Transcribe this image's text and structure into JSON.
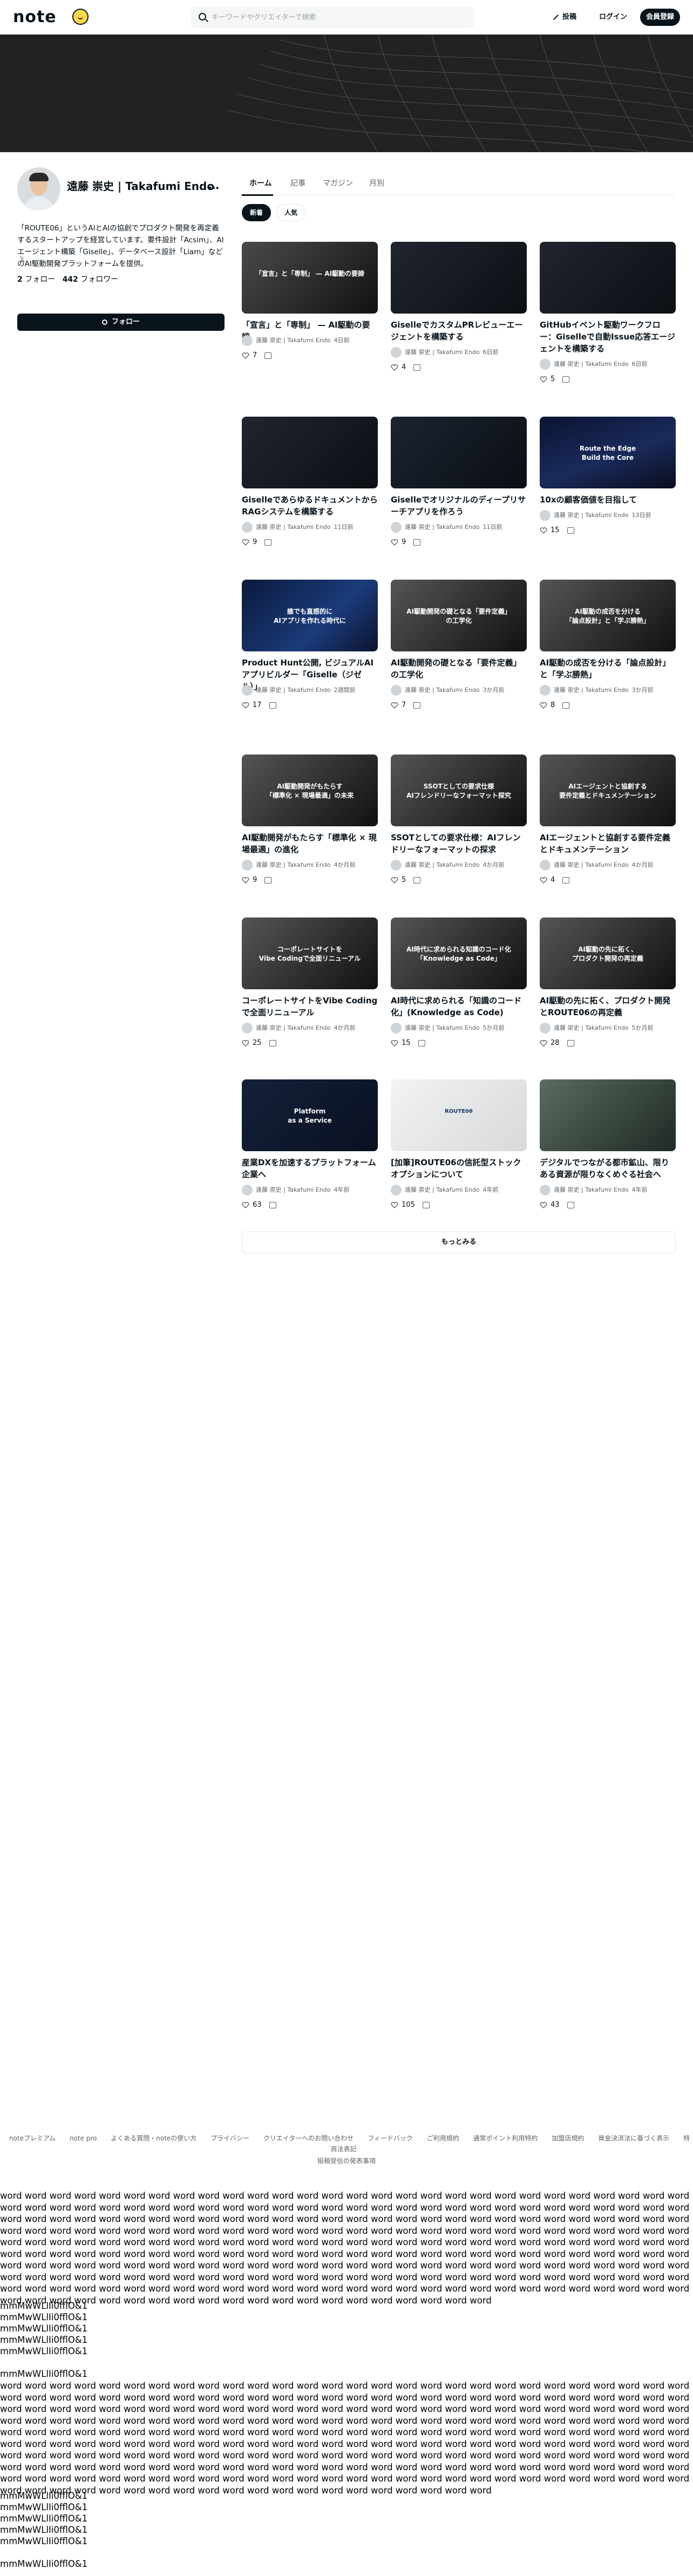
{
  "header": {
    "logo": "note",
    "search_placeholder": "キーワードやクリエイターで検索",
    "post_label": "投稿",
    "login_label": "ログイン",
    "signup_label": "会員登録"
  },
  "profile": {
    "name": "遠藤 崇史 | Takafumi Endo",
    "more": "…",
    "bio": "「ROUTE06」というAIとAIの協創でプロダクト開発を再定義するスタートアップを経営しています。要件設計「Acsim」、AIエージェント構築「Giselle」、データベース設計「Liam」などのAI駆動開発プラットフォームを提供。",
    "social": "𝕏",
    "follow_count": "2",
    "follow_label": "フォロー",
    "follower_count": "442",
    "follower_label": "フォロワー",
    "follow_button": "フォロー"
  },
  "tabs": [
    "ホーム",
    "記事",
    "マガジン",
    "月別"
  ],
  "chips": [
    "新着",
    "人気"
  ],
  "author": "遠藤 崇史 | Takafumi Endo",
  "articles": [
    {
      "thumb": "「宣言」と「専制」 — AI駆動の要諦",
      "title": "「宣言」と「専制」 — AI駆動の要諦",
      "time": "4日前",
      "likes": "7"
    },
    {
      "thumb": "",
      "title": "GiselleでカスタムPRレビューエージェントを構築する",
      "time": "6日前",
      "likes": "4"
    },
    {
      "thumb": "",
      "title": "GitHubイベント駆動ワークフロー：Giselleで自動Issue応答エージェントを構築する",
      "time": "6日前",
      "likes": "5"
    },
    {
      "thumb": "",
      "title": "GiselleであらゆるドキュメントからRAGシステムを構築する",
      "time": "11日前",
      "likes": "9"
    },
    {
      "thumb": "",
      "title": "Giselleでオリジナルのディープリサーチアプリを作ろう",
      "time": "11日前",
      "likes": "9"
    },
    {
      "thumb": "Route the Edge\nBuild the Core",
      "title": "10xの顧客価値を目指して",
      "time": "13日前",
      "likes": "15"
    },
    {
      "thumb": "誰でも直感的に\nAIアプリを作れる時代に",
      "title": "Product Hunt公開, ビジュアルAIアプリビルダー「Giselle（ジゼル）」",
      "time": "2週間前",
      "likes": "17"
    },
    {
      "thumb": "AI駆動開発の礎となる「要件定義」\nの工学化",
      "title": "AI駆動開発の礎となる「要件定義」の工学化",
      "time": "3か月前",
      "likes": "7"
    },
    {
      "thumb": "AI駆動の成否を分ける\n「論点設計」と「学ぶ勝熱」",
      "title": "AI駆動の成否を分ける「論点設計」と「学ぶ勝熱」",
      "time": "3か月前",
      "likes": "8"
    },
    {
      "thumb": "AI駆動開発がもたらす\n「標準化 × 現場最適」の未来",
      "title": "AI駆動開発がもたらす「標準化 × 現場最適」の進化",
      "time": "4か月前",
      "likes": "9"
    },
    {
      "thumb": "SSOTとしての要求仕様\nAIフレンドリーなフォーマット探究",
      "title": "SSOTとしての要求仕様：AIフレンドリーなフォーマットの探求",
      "time": "4か月前",
      "likes": "5"
    },
    {
      "thumb": "AIエージェントと協創する\n要件定義とドキュメンテーション",
      "title": "AIエージェントと協創する要件定義とドキュメンテーション",
      "time": "4か月前",
      "likes": "4"
    },
    {
      "thumb": "コーポレートサイトを\nVibe Codingで全面リニューアル",
      "title": "コーポレートサイトをVibe Codingで全面リニューアル",
      "time": "4か月前",
      "likes": "25"
    },
    {
      "thumb": "AI時代に求められる知識のコード化\n「Knowledge as Code」",
      "title": "AI時代に求められる「知識のコード化」(Knowledge as Code)",
      "time": "5か月前",
      "likes": "15"
    },
    {
      "thumb": "AI駆動の先に拓く、\nプロダクト開発の再定義",
      "title": "AI駆動の先に拓く、プロダクト開発とROUTE06の再定義",
      "time": "5か月前",
      "likes": "28"
    },
    {
      "thumb": "Platform\nas a Service",
      "title": "産業DXを加速するプラットフォーム企業へ",
      "time": "4年前",
      "likes": "63"
    },
    {
      "thumb": "ROUTE06",
      "title": "[加筆]ROUTE06の信託型ストックオプションについて",
      "time": "4年前",
      "likes": "105"
    },
    {
      "thumb": "",
      "title": "デジタルでつながる都市鉱山、限りある資源が限りなくめぐる社会へ",
      "time": "4年前",
      "likes": "43"
    }
  ],
  "more_button": "もっとみる",
  "footer": {
    "links": [
      "noteプレミアム",
      "note pro",
      "よくある質問・noteの使い方",
      "プライバシー",
      "クリエイターへのお問い合わせ",
      "フィードバック",
      "ご利用規約",
      "通常ポイント利用特約",
      "加盟店規約",
      "資金決済法に基づく表示",
      "特商法表記"
    ],
    "link2": "投稿受信の発表事項"
  },
  "test_words": "word word word word word word word word word word word word word word word word word word word word word word word word word word word word word word word word word word word word word word word word word word word word word word word word word word word word word word word word word word word word word word word word word word word word word word word word word word word word word word word word word word word word word word word word word word word word word word word word word word word word word word word word word word word word word word word word word word word word word word word word word word word word word word word word word word word word word word word word word word word word word word word word word word word word word word word word word word word word word word word word word word word word word word word word word word word word word word word word word word word word word word word word word word word word word word word word word word word word word word word word word word word word word word word word word word word word word word word word word word word word word word word word word word word word word word word word word word word word word word word word word word word word word word word word word word word word word word word word word word word word word word word word word word word word word word word word",
  "test_glyphs": [
    "mmMwWLlIi0fflO&1",
    "mmMwWLlIi0fflO&1",
    "mmMwWLlIi0fflO&1",
    "mmMwWLlIi0fflO&1",
    "mmMwWLlIi0fflO&1"
  ]
}
